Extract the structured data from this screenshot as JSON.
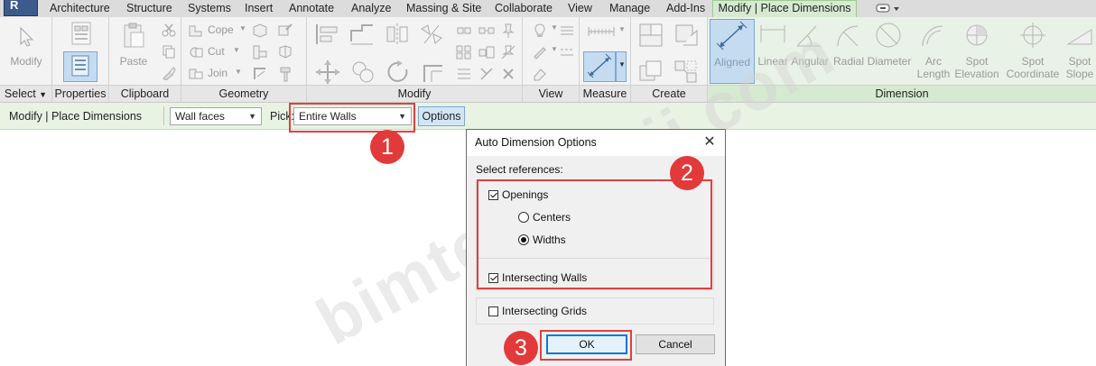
{
  "tabs": [
    "Architecture",
    "Structure",
    "Systems",
    "Insert",
    "Annotate",
    "Analyze",
    "Massing & Site",
    "Collaborate",
    "View",
    "Manage",
    "Add-Ins"
  ],
  "active_tab": "Modify | Place Dimensions",
  "ribbon": {
    "select": {
      "modify_label": "Modify",
      "panel": "Select",
      "panel_arrow": "▼"
    },
    "properties": {
      "panel": "Properties"
    },
    "clipboard": {
      "paste_label": "Paste",
      "panel": "Clipboard"
    },
    "geometry": {
      "cope": "Cope",
      "cut": "Cut",
      "join": "Join",
      "panel": "Geometry"
    },
    "modify": {
      "panel": "Modify"
    },
    "view": {
      "panel": "View"
    },
    "measure": {
      "panel": "Measure"
    },
    "create": {
      "panel": "Create"
    },
    "dimension": {
      "panel": "Dimension",
      "tools": [
        {
          "label": "Aligned",
          "selected": true
        },
        {
          "label": "Linear"
        },
        {
          "label": "Angular"
        },
        {
          "label": "Radial"
        },
        {
          "label": "Diameter"
        },
        {
          "label": "Arc\nLength"
        },
        {
          "label": "Spot\nElevation"
        },
        {
          "label": "Spot\nCoordinate"
        },
        {
          "label": "Spot\nSlope"
        }
      ]
    }
  },
  "options_bar": {
    "title": "Modify | Place Dimensions",
    "reference_type": "Wall faces",
    "pick_label": "Pick:",
    "pick_value": "Entire Walls",
    "options_button": "Options"
  },
  "dialog": {
    "title": "Auto Dimension Options",
    "close": "✕",
    "select_references": "Select references:",
    "openings": {
      "label": "Openings",
      "checked": true
    },
    "centers": {
      "label": "Centers",
      "selected": false
    },
    "widths": {
      "label": "Widths",
      "selected": true
    },
    "intersecting_walls": {
      "label": "Intersecting Walls",
      "checked": true
    },
    "intersecting_grids": {
      "label": "Intersecting Grids",
      "checked": false
    },
    "ok": "OK",
    "cancel": "Cancel"
  },
  "callouts": [
    "1",
    "2",
    "3"
  ],
  "watermark": "bimteknoloji.com",
  "colors": {
    "accent_red": "#e23a3a",
    "context_green": "#d6ead1",
    "selection_blue": "#c5dcf0"
  }
}
